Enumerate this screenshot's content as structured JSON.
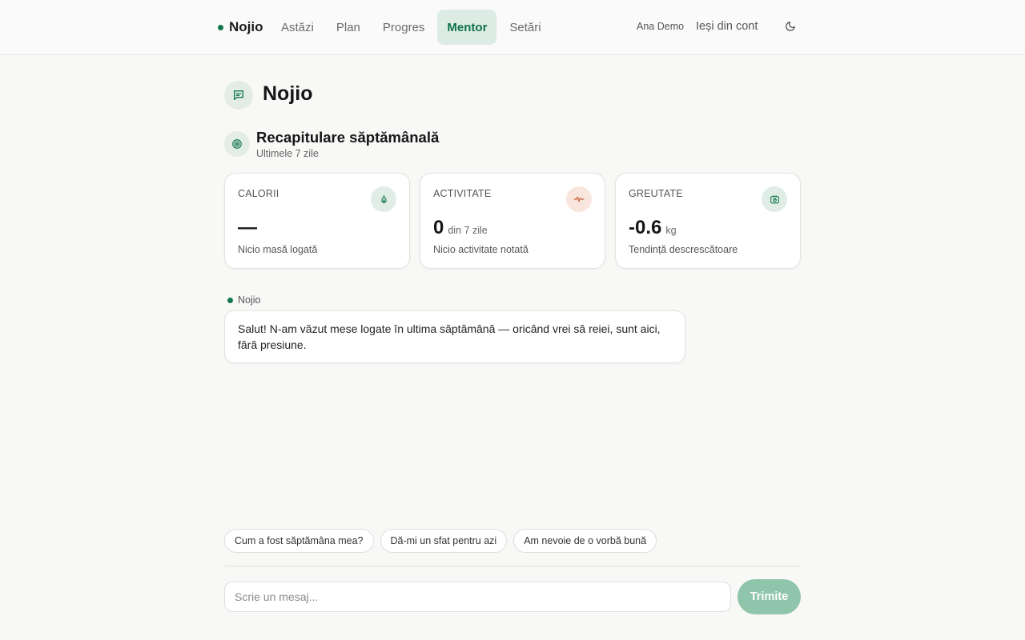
{
  "app": {
    "brand": "Nojio",
    "accent_color": "#11774f"
  },
  "nav": {
    "items": [
      {
        "label": "Astăzi",
        "active": false
      },
      {
        "label": "Plan",
        "active": false
      },
      {
        "label": "Progres",
        "active": false
      },
      {
        "label": "Mentor",
        "active": true
      },
      {
        "label": "Setări",
        "active": false
      }
    ],
    "user_name": "Ana Demo",
    "logout_label": "Ieși din cont",
    "theme_icon": "moon-icon"
  },
  "page": {
    "title": "Nojio",
    "icon": "chat-icon"
  },
  "recap": {
    "title": "Recapitulare săptămânală",
    "subtitle": "Ultimele 7 zile",
    "icon": "target-icon",
    "cards": [
      {
        "label": "CALORII",
        "value": "—",
        "unit": "",
        "description": "Nicio masă logată",
        "icon": "flame-icon",
        "icon_color": "#11774f"
      },
      {
        "label": "ACTIVITATE",
        "value": "0",
        "unit": "din 7 zile",
        "description": "Nicio activitate notată",
        "icon": "pulse-icon",
        "icon_color": "#c8653b"
      },
      {
        "label": "GREUTATE",
        "value": "-0.6",
        "unit": "kg",
        "description": "Tendință descrescătoare",
        "icon": "scale-icon",
        "icon_color": "#11774f"
      }
    ]
  },
  "chat": {
    "messages": [
      {
        "sender": "Nojio",
        "text": "Salut! N-am văzut mese logate în ultima săptămână — oricând vrei să reiei, sunt aici, fără presiune."
      }
    ],
    "suggestions": [
      "Cum a fost săptămâna mea?",
      "Dă-mi un sfat pentru azi",
      "Am nevoie de o vorbă bună"
    ],
    "input_placeholder": "Scrie un mesaj...",
    "send_label": "Trimite"
  }
}
